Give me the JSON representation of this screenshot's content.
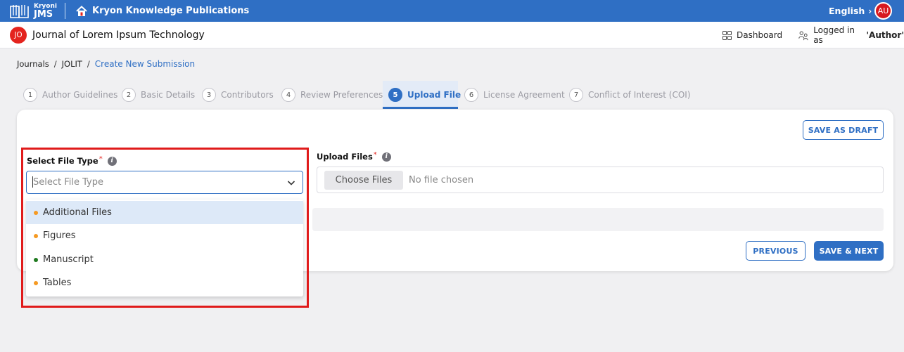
{
  "topbar": {
    "brand_small": "Kryoni",
    "brand_big": "JMS",
    "publisher": "Kryon Knowledge Publications",
    "language": "English",
    "user_initials": "AU",
    "colors": {
      "bar": "#2f6fc4",
      "avatar": "#d71920"
    }
  },
  "header": {
    "journal_initials": "JO",
    "journal_title": "Journal of Lorem Ipsum Technology",
    "dashboard_label": "Dashboard",
    "logged_in_prefix": "Logged in as",
    "logged_in_user": "'Author'"
  },
  "breadcrumb": {
    "items": [
      "Journals",
      "JOLIT",
      "Create New Submission"
    ]
  },
  "steps": [
    {
      "num": "1",
      "label": "Author Guidelines"
    },
    {
      "num": "2",
      "label": "Basic Details"
    },
    {
      "num": "3",
      "label": "Contributors"
    },
    {
      "num": "4",
      "label": "Review Preferences"
    },
    {
      "num": "5",
      "label": "Upload File",
      "active": true
    },
    {
      "num": "6",
      "label": "License Agreement"
    },
    {
      "num": "7",
      "label": "Conflict of Interest (COI)"
    }
  ],
  "form": {
    "save_draft": "SAVE AS DRAFT",
    "file_type_label": "Select File Type",
    "required_mark": "*",
    "info_glyph": "i",
    "file_type_placeholder": "Select File Type",
    "upload_label": "Upload Files",
    "choose_files": "Choose Files",
    "no_file": "No file chosen",
    "previous": "PREVIOUS",
    "save_next": "SAVE & NEXT"
  },
  "dropdown": {
    "options": [
      {
        "label": "Additional Files",
        "dot_color": "#f59a23",
        "highlighted": true
      },
      {
        "label": "Figures",
        "dot_color": "#f59a23"
      },
      {
        "label": "Manuscript",
        "dot_color": "#1f7a1f"
      },
      {
        "label": "Tables",
        "dot_color": "#f59a23"
      }
    ]
  }
}
